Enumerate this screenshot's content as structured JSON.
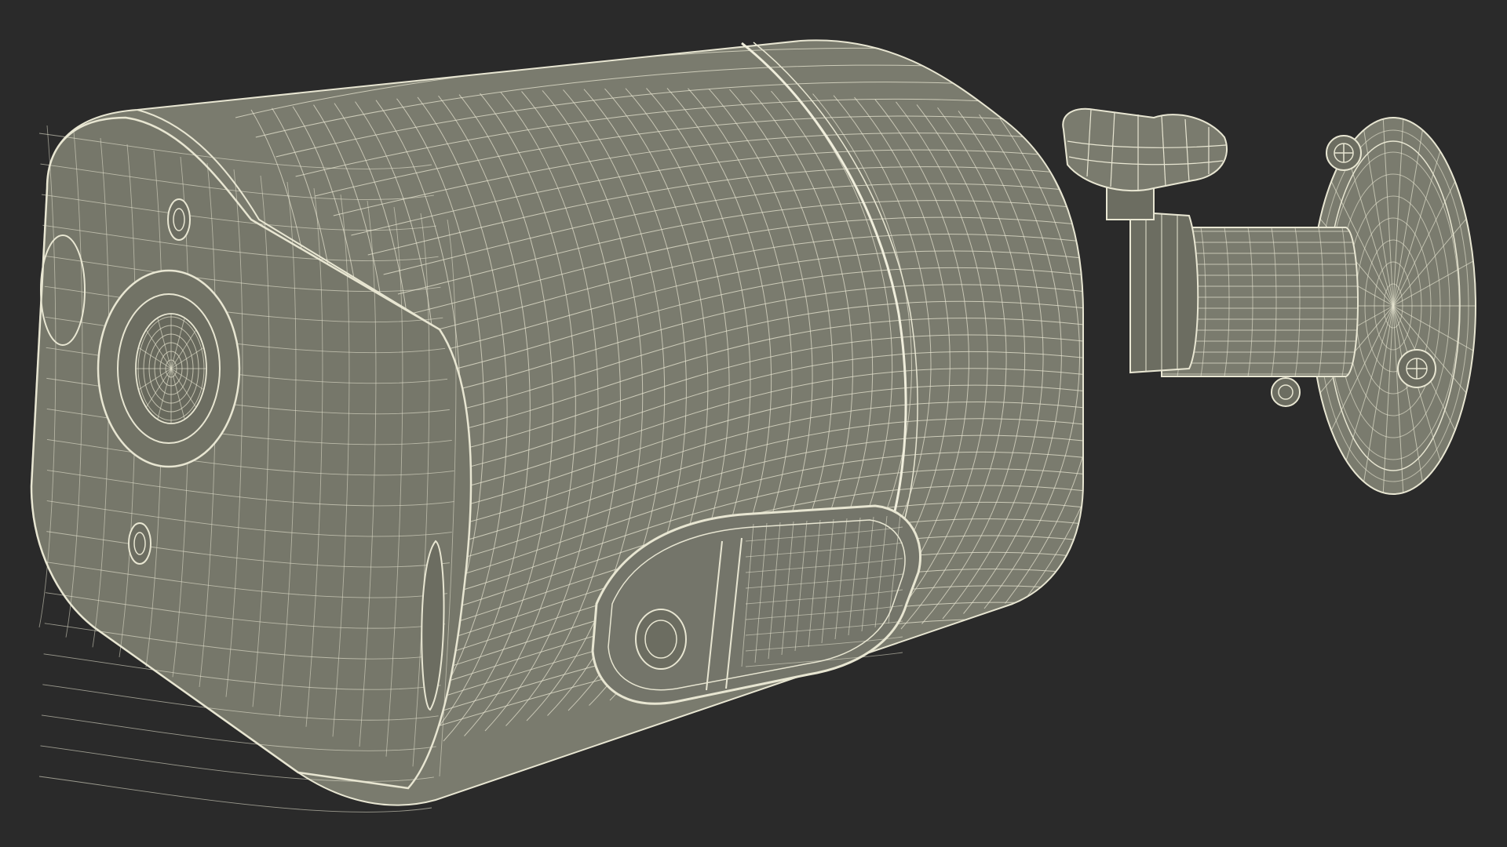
{
  "scene": {
    "subject": "security-camera-wireframe",
    "style": "wireframe-render"
  },
  "colors": {
    "background": "#2a2a2a",
    "surface": "#7a7b6e",
    "surface_dark": "#6c6d61",
    "surface_light": "#8a8b7d",
    "wire": "#e8e6d2",
    "wire_faint": "#cfcdb8"
  },
  "icons": {
    "lens": "camera-lens-icon",
    "screw": "screw-head-icon",
    "knob": "adjustment-knob-icon"
  }
}
